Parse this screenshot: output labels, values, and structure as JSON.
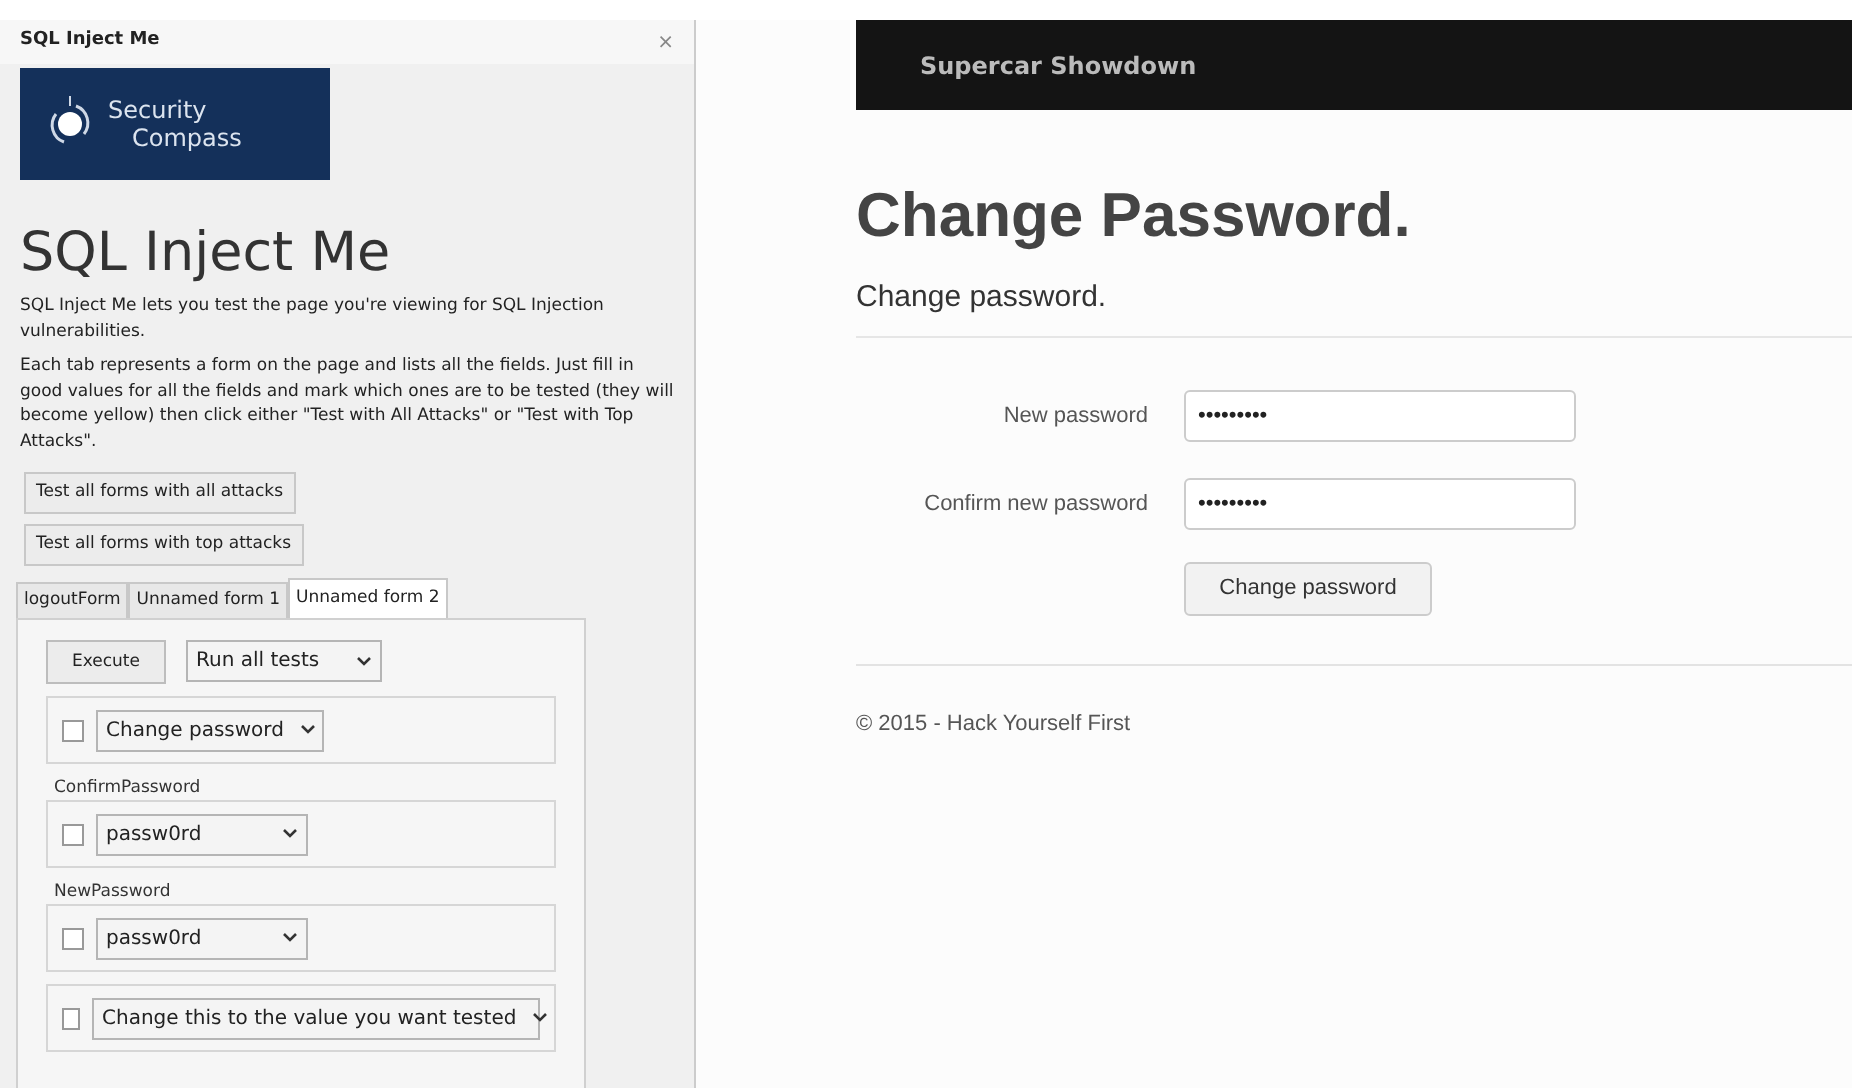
{
  "sidebar": {
    "title": "SQL Inject Me",
    "close": "×",
    "logo": [
      "Security",
      "Compass"
    ],
    "heading": "SQL Inject Me",
    "paragraphs": [
      "SQL Inject Me lets you test the page you're viewing for SQL Injection vulnerabilities.",
      "Each tab represents a form on the page and lists all the fields. Just fill in good values for all the fields and mark which ones are to be tested (they will become yellow) then click either \"Test with All Attacks\" or \"Test with Top Attacks\"."
    ],
    "buttons": [
      "Test all forms with all attacks",
      "Test all forms with top attacks"
    ],
    "tabs": [
      {
        "label": "logoutForm",
        "selected": false
      },
      {
        "label": "Unnamed form 1",
        "selected": false
      },
      {
        "label": "Unnamed form 2",
        "selected": true
      }
    ],
    "execute": "Execute",
    "run_select": "Run all tests",
    "fields": [
      {
        "checked": false,
        "value": "Change password"
      },
      {
        "label": "ConfirmPassword",
        "checked": false,
        "value": "passw0rd"
      },
      {
        "label": "NewPassword",
        "checked": false,
        "value": "passw0rd"
      },
      {
        "checked": false,
        "value": "Change this to the value you want tested"
      }
    ]
  },
  "page": {
    "brand": "Supercar Showdown",
    "title": "Change Password.",
    "subtitle": "Change password.",
    "fields": [
      {
        "label": "New password",
        "value": "•••••••••"
      },
      {
        "label": "Confirm new password",
        "value": "•••••••••"
      }
    ],
    "button": "Change password",
    "footer": "© 2015 - Hack Yourself First"
  }
}
